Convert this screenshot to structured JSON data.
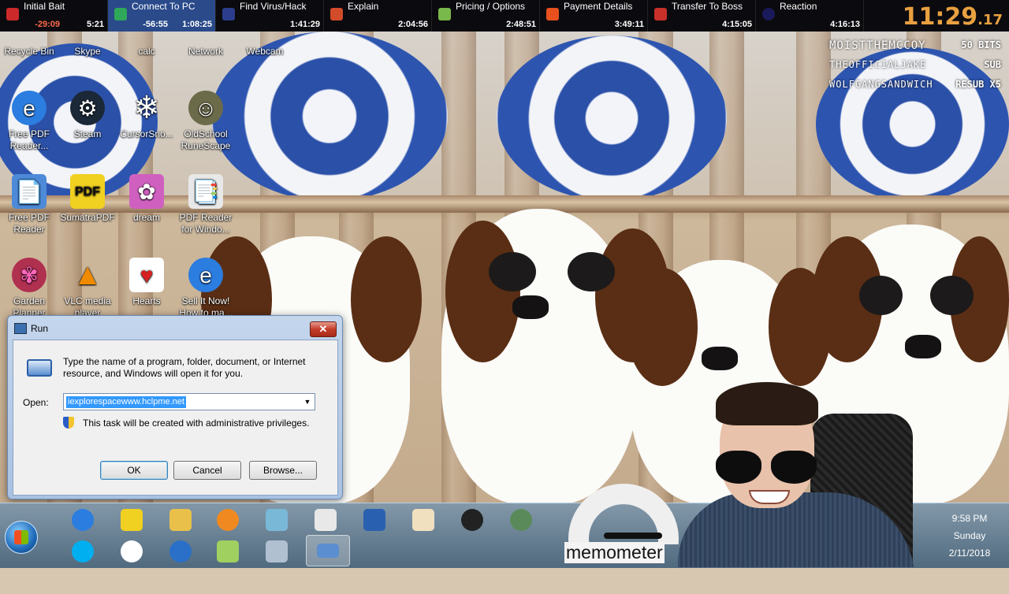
{
  "topbar": {
    "segments": [
      {
        "name": "Initial Bait",
        "t1": "-29:09",
        "t2": "5:21",
        "color": "#cc2a2a"
      },
      {
        "name": "Connect To PC",
        "t1": "-56:55",
        "t2": "1:08:25",
        "color": "#2fa85a"
      },
      {
        "name": "Find Virus/Hack",
        "t1": "",
        "t2": "1:41:29",
        "color": "#2b3d8c"
      },
      {
        "name": "Explain",
        "t1": "",
        "t2": "2:04:56",
        "color": "#d24b2a"
      },
      {
        "name": "Pricing / Options",
        "t1": "",
        "t2": "2:48:51",
        "color": "#79b84a"
      },
      {
        "name": "Payment Details",
        "t1": "",
        "t2": "3:49:11",
        "color": "#e8501e"
      },
      {
        "name": "Transfer To Boss",
        "t1": "",
        "t2": "4:15:05",
        "color": "#c8302a"
      },
      {
        "name": "Reaction",
        "t1": "",
        "t2": "4:16:13",
        "color": "#1a1a5a"
      }
    ],
    "clock": {
      "main": "11:29",
      "frac": ".17"
    }
  },
  "desktop_icons": [
    {
      "label": "Recycle Bin",
      "glyph": "🗑",
      "bg": "#6a7d93"
    },
    {
      "label": "Skype",
      "glyph": "S",
      "bg": "#00aff0"
    },
    {
      "label": "calc",
      "glyph": "▦",
      "bg": "#8aa0b8"
    },
    {
      "label": "Network",
      "glyph": "🖧",
      "bg": "#5d7fa8"
    },
    {
      "label": "Webcam",
      "glyph": "◉",
      "bg": "#555"
    },
    {
      "label": "Free PDF Reader...",
      "glyph": "e",
      "bg": "#2b7de0"
    },
    {
      "label": "Steam",
      "glyph": "⚙",
      "bg": "#1b2838"
    },
    {
      "label": "CursorSno...",
      "glyph": "❄",
      "bg": "transparent"
    },
    {
      "label": "OldSchool RuneScape",
      "glyph": "☺",
      "bg": "#6b6b4a"
    },
    {
      "label": "Free PDF Reader",
      "glyph": "📄",
      "bg": "#4d8ad8"
    },
    {
      "label": "SumatraPDF",
      "glyph": "PDF",
      "bg": "#f0d020"
    },
    {
      "label": "dream",
      "glyph": "✿",
      "bg": "#d060c0"
    },
    {
      "label": "PDF Reader for Windo...",
      "glyph": "📑",
      "bg": "#e8e8e8"
    },
    {
      "label": "Garden Planner",
      "glyph": "✾",
      "bg": "#b03050"
    },
    {
      "label": "VLC media player",
      "glyph": "▲",
      "bg": "#f08a00"
    },
    {
      "label": "Hearts",
      "glyph": "♥",
      "bg": "#d82020"
    },
    {
      "label": "Sell It Now! How to ma...",
      "glyph": "e",
      "bg": "#2b7de0"
    }
  ],
  "subs": [
    {
      "name": "MOISTTHEMCCOY",
      "kind": "50 BITS"
    },
    {
      "name": "THEOFFICIALJAKE",
      "kind": "SUB"
    },
    {
      "name": "WOLFGANGSANDWICH",
      "kind": "RESUB X5"
    }
  ],
  "run": {
    "title": "Run",
    "close": "✕",
    "description": "Type the name of a program, folder, document, or Internet resource, and Windows will open it for you.",
    "open_label": "Open:",
    "open_value": "iexplorespacewww.hclpme.net",
    "admin_note": "This task will be created with administrative privileges.",
    "ok": "OK",
    "cancel": "Cancel",
    "browse": "Browse..."
  },
  "taskbar": {
    "row1": [
      {
        "name": "internet-explorer",
        "color": "#2b7de0"
      },
      {
        "name": "sumatra-pdf",
        "color": "#f0d020"
      },
      {
        "name": "file-explorer",
        "color": "#e8c04a"
      },
      {
        "name": "media-player",
        "color": "#f08a20"
      },
      {
        "name": "notepad",
        "color": "#7ab8d8"
      },
      {
        "name": "solitaire",
        "color": "#e8e8e8"
      },
      {
        "name": "magnifier",
        "color": "#2a60b0"
      },
      {
        "name": "mahjong",
        "color": "#f0e0c0"
      },
      {
        "name": "dell",
        "color": "#222"
      },
      {
        "name": "chess",
        "color": "#5a8a5a"
      }
    ],
    "row2": [
      {
        "name": "skype",
        "color": "#00aff0"
      },
      {
        "name": "cursor-snow",
        "color": "#ffffff"
      },
      {
        "name": "planet",
        "color": "#2a70c8"
      },
      {
        "name": "sticky-notes",
        "color": "#a0d060"
      },
      {
        "name": "calculator",
        "color": "#b0c0d0"
      },
      {
        "name": "run",
        "color": "#5a8ed0"
      }
    ]
  },
  "tray": {
    "time": "9:58 PM",
    "day": "Sunday",
    "date": "2/11/2018"
  },
  "memometer": {
    "label": "memometer"
  }
}
